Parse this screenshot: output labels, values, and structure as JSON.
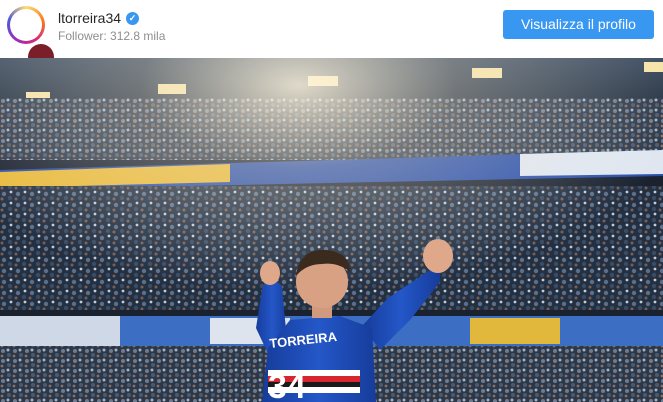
{
  "header": {
    "username": "ltorreira34",
    "followers": "Follower: 312.8 mila",
    "cta_label": "Visualizza il profilo",
    "verified_icon": "verified-badge-icon",
    "verified_glyph": "✓"
  },
  "photo": {
    "jersey_name": "TORREIRA",
    "jersey_number": "34"
  },
  "colors": {
    "accent": "#3897f0",
    "username": "#262626",
    "muted": "#8e8e8e",
    "jersey_blue": "#1f4fb5",
    "stadium_dark": "#1a2230"
  }
}
